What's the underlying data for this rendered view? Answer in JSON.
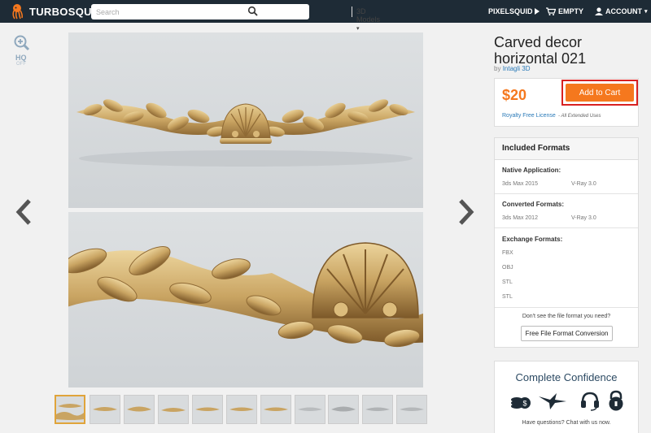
{
  "brand": {
    "name": "TURBOSQUID",
    "color": "#1e2b36",
    "accent": "#f5781e"
  },
  "search": {
    "placeholder": "Search",
    "category": "3D Models"
  },
  "nav": {
    "pixelsquid": "PIXELSQUID",
    "cart": "EMPTY",
    "account": "ACCOUNT"
  },
  "viewer": {
    "hq_label": "HQ",
    "hq_state": "OFF",
    "icons": [
      "zoom-in-icon",
      "chevron-left-icon",
      "chevron-right-icon"
    ]
  },
  "product": {
    "title": "Carved decor horizontal 021",
    "by_prefix": "by",
    "author": "Intagli 3D",
    "price": "$20",
    "add_to_cart": "Add to Cart",
    "license": "Royalty Free License",
    "license_note": "- All Extended Uses"
  },
  "formats": {
    "title": "Included Formats",
    "native": {
      "label": "Native Application:",
      "items": [
        "3ds Max 2015",
        "V-Ray 3.0"
      ]
    },
    "converted": {
      "label": "Converted Formats:",
      "items": [
        "3ds Max 2012",
        "V-Ray 3.0"
      ]
    },
    "exchange": {
      "label": "Exchange Formats:",
      "items": [
        "FBX",
        "OBJ",
        "STL",
        "STL"
      ]
    },
    "question": "Don't see the file format you need?",
    "convert_button": "Free File Format Conversion"
  },
  "confidence": {
    "title": "Complete Confidence",
    "icons": [
      "money-icon",
      "bird-icon",
      "headset-icon",
      "lock-icon"
    ],
    "chat": "Have questions? Chat with us now."
  }
}
